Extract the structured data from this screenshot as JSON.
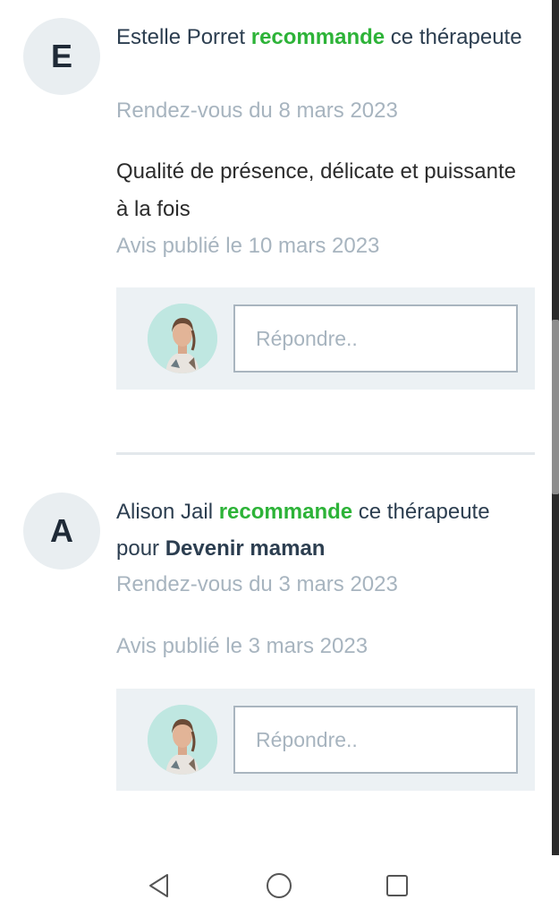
{
  "reviews": [
    {
      "initial": "E",
      "name": "Estelle Porret",
      "recommend_word": "recommande",
      "suffix": "ce thérapeute",
      "appointment": "Rendez-vous du 8 mars 2023",
      "comment": "Qualité de présence, délicate et puissante à la fois",
      "published": "Avis publié le 10 mars 2023",
      "reply_placeholder": "Répondre.."
    },
    {
      "initial": "A",
      "name": "Alison Jail",
      "recommend_word": "recommande",
      "suffix": "ce thérapeute",
      "for_word": "pour",
      "topic": "Devenir maman",
      "appointment": "Rendez-vous du 3 mars 2023",
      "published": "Avis publié le 3 mars 2023",
      "reply_placeholder": "Répondre.."
    }
  ],
  "colors": {
    "recommend": "#2db338",
    "meta": "#a7b4bf",
    "reply_bg": "#ecf1f4"
  },
  "navigation": {
    "back_icon": "back-triangle-icon",
    "home_icon": "home-circle-icon",
    "recents_icon": "recents-square-icon"
  }
}
